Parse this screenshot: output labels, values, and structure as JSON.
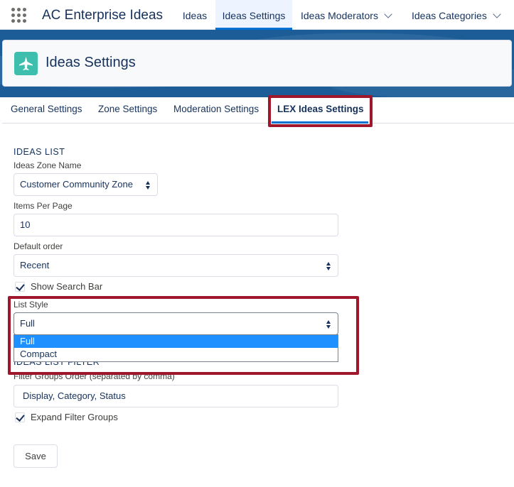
{
  "app": {
    "name": "AC Enterprise Ideas"
  },
  "nav": {
    "tabs": [
      {
        "label": "Ideas"
      },
      {
        "label": "Ideas Settings"
      },
      {
        "label": "Ideas Moderators"
      },
      {
        "label": "Ideas Categories"
      }
    ]
  },
  "header": {
    "title": "Ideas Settings",
    "icon": "lightbulb-icon"
  },
  "settings_tabs": [
    {
      "label": "General Settings"
    },
    {
      "label": "Zone Settings"
    },
    {
      "label": "Moderation Settings"
    },
    {
      "label": "LEX Ideas Settings"
    }
  ],
  "ideas_list": {
    "title": "IDEAS LIST",
    "zone_label": "Ideas Zone Name",
    "zone_value": "Customer Community Zone",
    "items_label": "Items Per Page",
    "items_value": "10",
    "order_label": "Default order",
    "order_value": "Recent",
    "search_bar_label": "Show Search Bar",
    "list_style_label": "List Style",
    "list_style_value": "Full",
    "list_style_options": [
      "Full",
      "Compact"
    ]
  },
  "ideas_list_filter": {
    "title": "IDEAS LIST FILTER",
    "groups_label": "Filter Groups Order (separated by comma)",
    "groups_value": "Display, Category, Status",
    "expand_label": "Expand Filter Groups"
  },
  "buttons": {
    "save": "Save"
  },
  "colors": {
    "highlight": "#a0172b",
    "brand": "#1c5d97",
    "accent": "#0070d2",
    "icon_bg": "#3ebfae"
  }
}
